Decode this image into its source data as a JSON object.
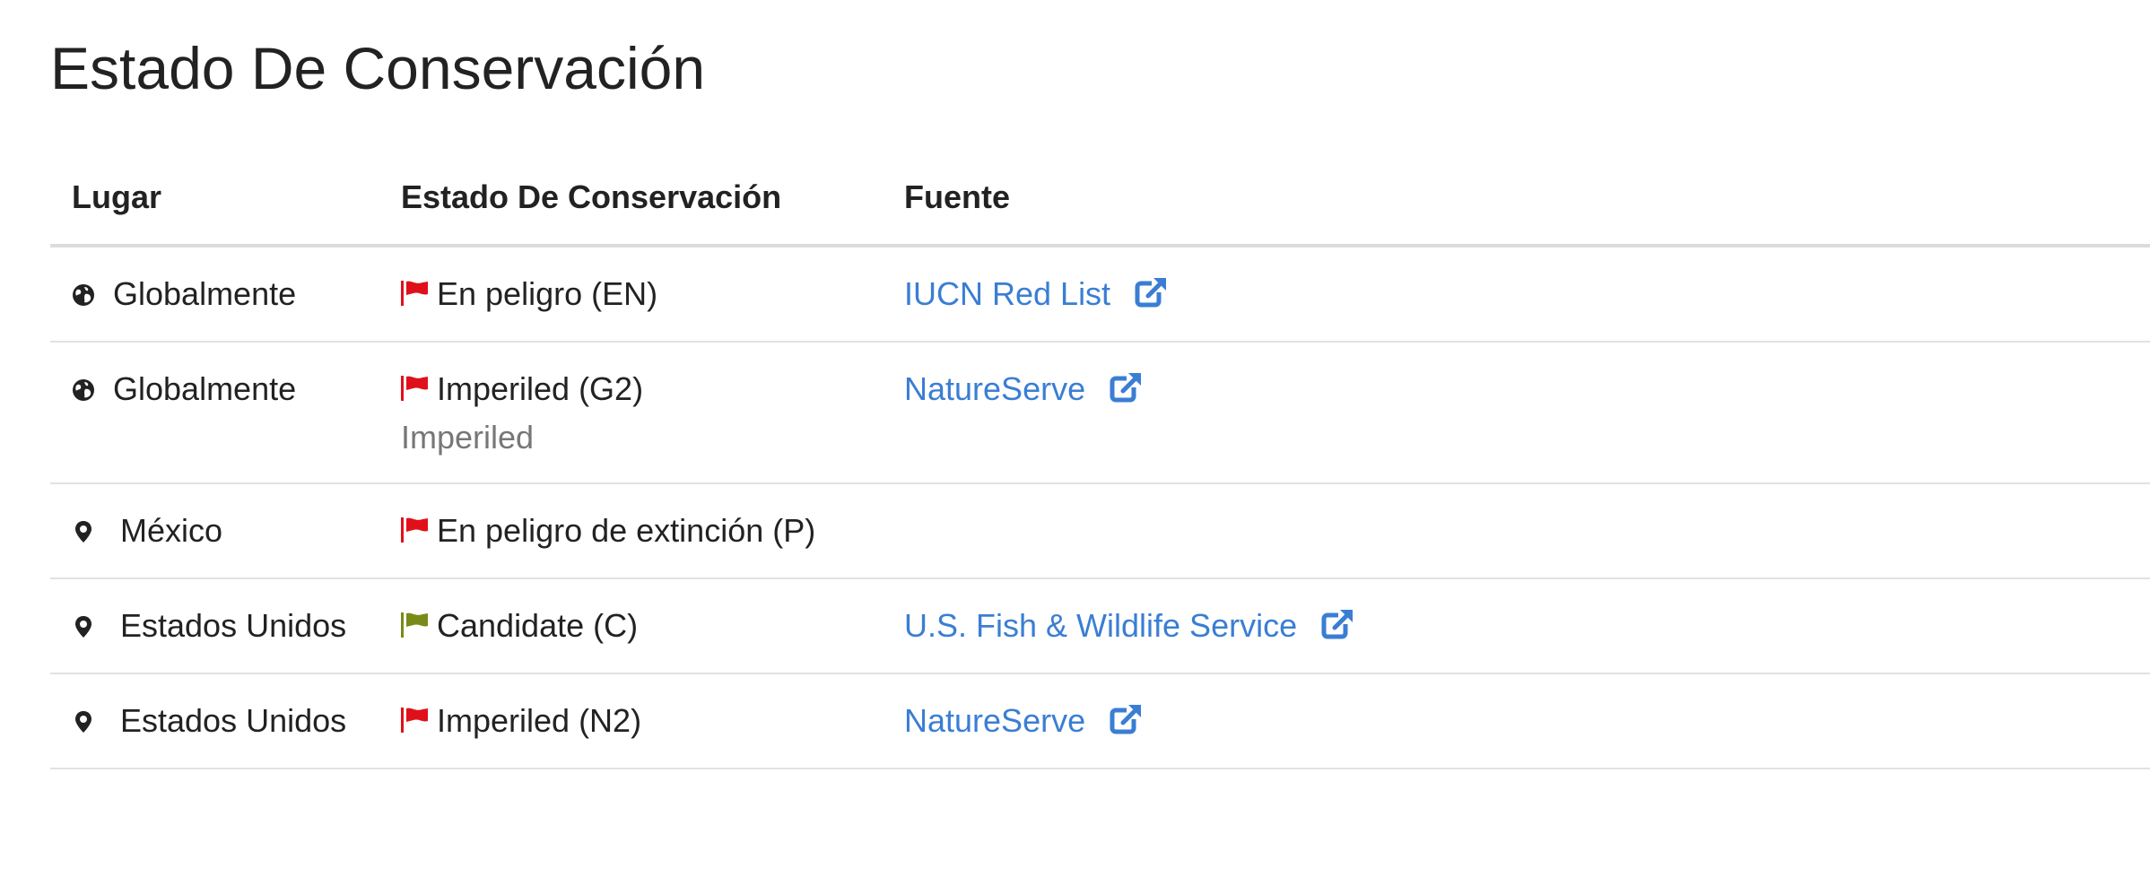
{
  "page": {
    "title": "Estado De Conservación"
  },
  "table": {
    "headers": {
      "place": "Lugar",
      "status": "Estado De Conservación",
      "source": "Fuente"
    },
    "rows": [
      {
        "place_icon": "globe-icon",
        "place": "Globalmente",
        "flag_icon": "flag-icon",
        "flag_color": "#e0101a",
        "status": "En peligro (EN)",
        "status_sub": "",
        "source": "IUCN Red List",
        "source_icon": "external-link-icon"
      },
      {
        "place_icon": "globe-icon",
        "place": "Globalmente",
        "flag_icon": "flag-icon",
        "flag_color": "#e0101a",
        "status": "Imperiled (G2)",
        "status_sub": "Imperiled",
        "source": "NatureServe",
        "source_icon": "external-link-icon"
      },
      {
        "place_icon": "map-pin-icon",
        "place": "México",
        "flag_icon": "flag-icon",
        "flag_color": "#e0101a",
        "status": "En peligro de extinción (P)",
        "status_sub": "",
        "source": "",
        "source_icon": ""
      },
      {
        "place_icon": "map-pin-icon",
        "place": "Estados Unidos",
        "flag_icon": "flag-icon",
        "flag_color": "#7a8a1a",
        "status": "Candidate (C)",
        "status_sub": "",
        "source": "U.S. Fish & Wildlife Service",
        "source_icon": "external-link-icon"
      },
      {
        "place_icon": "map-pin-icon",
        "place": "Estados Unidos",
        "flag_icon": "flag-icon",
        "flag_color": "#e0101a",
        "status": "Imperiled (N2)",
        "status_sub": "",
        "source": "NatureServe",
        "source_icon": "external-link-icon"
      }
    ]
  },
  "colors": {
    "link": "#3a7ed4",
    "text": "#222222",
    "muted": "#777777",
    "flag_red": "#e0101a",
    "flag_olive": "#7a8a1a"
  }
}
